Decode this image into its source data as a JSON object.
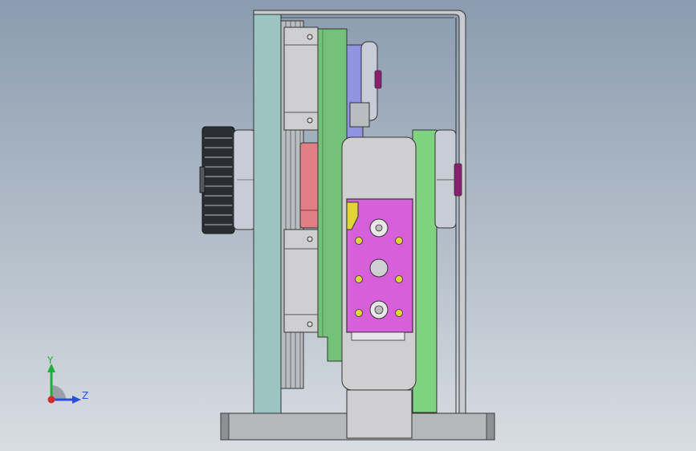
{
  "viewport": {
    "background_top": "#8b9cb0",
    "background_bottom": "#d8dde2"
  },
  "triad": {
    "y_label": "Y",
    "z_label": "Z",
    "y_color": "#1fae3a",
    "z_color": "#2a4fd6",
    "x_color": "#d62a2a"
  },
  "colors": {
    "panel_teal": "#9cc4c0",
    "frame_grey": "#b5b9bc",
    "slab_green": "#74c27a",
    "spacer_green": "#7fd27f",
    "block_light": "#cfcfd2",
    "motor_magenta": "#d75fd9",
    "bolt_yellow": "#e2d43a",
    "pulley_dark": "#2b2f34",
    "roller_silver": "#c8ccd6",
    "gear_salmon": "#e07f86",
    "knob_purple": "#8a1f6e",
    "slab_blue": "#8f93e0"
  }
}
